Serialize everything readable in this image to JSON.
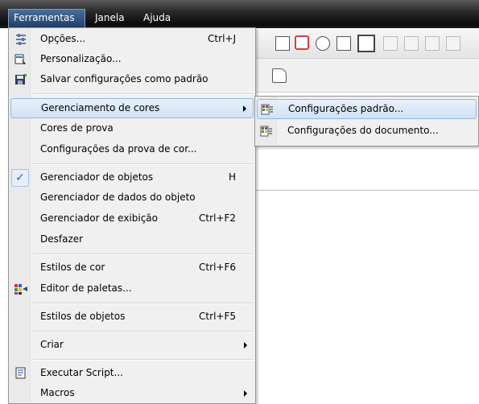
{
  "menubar": {
    "items": [
      {
        "label": "Ferramentas",
        "active": true
      },
      {
        "label": "Janela"
      },
      {
        "label": "Ajuda"
      }
    ]
  },
  "menu": {
    "items": [
      {
        "label": "Opções...",
        "shortcut": "Ctrl+J",
        "icon": "options-icon"
      },
      {
        "label": "Personalização...",
        "icon": "customization-icon"
      },
      {
        "label": "Salvar configurações como padrão",
        "icon": "save-defaults-icon"
      },
      {
        "label": "Gerenciamento de cores",
        "submenu": true,
        "highlighted": true
      },
      {
        "label": "Cores de prova"
      },
      {
        "label": "Configurações da prova de cor..."
      },
      {
        "label": "Gerenciador de objetos",
        "shortcut": "H",
        "checked": true
      },
      {
        "label": "Gerenciador de dados do objeto"
      },
      {
        "label": "Gerenciador de exibição",
        "shortcut": "Ctrl+F2"
      },
      {
        "label": "Desfazer"
      },
      {
        "label": "Estilos de cor",
        "shortcut": "Ctrl+F6"
      },
      {
        "label": "Editor de paletas...",
        "icon": "palette-editor-icon"
      },
      {
        "label": "Estilos de objetos",
        "shortcut": "Ctrl+F5"
      },
      {
        "label": "Criar",
        "submenu": true
      },
      {
        "label": "Executar Script...",
        "icon": "script-icon"
      },
      {
        "label": "Macros",
        "submenu": true
      }
    ]
  },
  "submenu": {
    "items": [
      {
        "label": "Configurações padrão...",
        "icon": "color-settings-icon",
        "highlighted": true
      },
      {
        "label": "Configurações do documento...",
        "icon": "document-color-settings-icon"
      }
    ]
  },
  "colors": {
    "menu_bg": "#f0f0f0",
    "highlight": "#cfe2f6",
    "menubar_bg": "#1a1a1a"
  }
}
